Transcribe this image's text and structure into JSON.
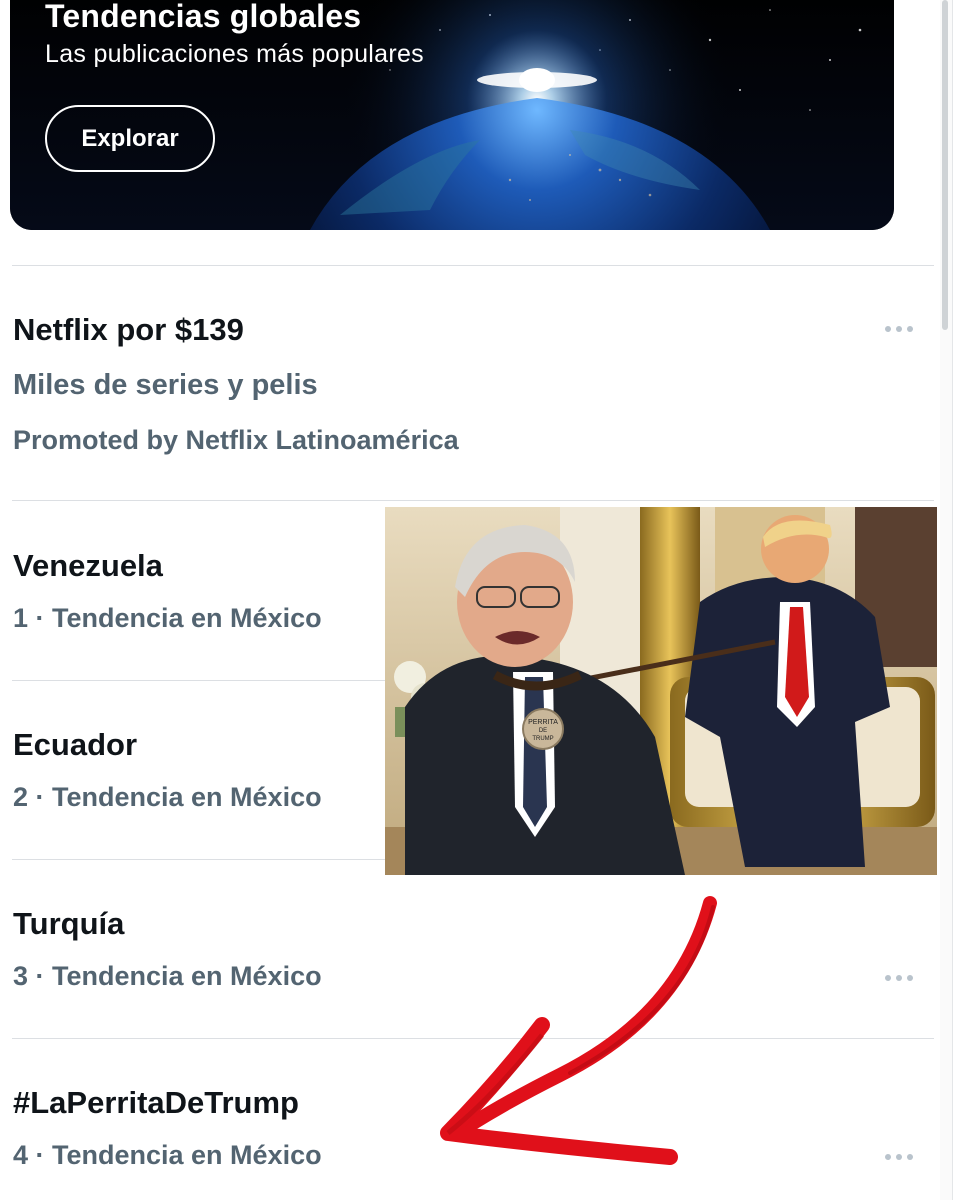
{
  "banner": {
    "title": "Tendencias globales",
    "subtitle": "Las publicaciones más populares",
    "button_label": "Explorar"
  },
  "promoted": {
    "title": "Netflix por $139",
    "subtitle": "Miles de series y pelis",
    "sponsor": "Promoted by Netflix Latinoamérica"
  },
  "trends": [
    {
      "title": "Venezuela",
      "meta": "1 · Tendencia en México"
    },
    {
      "title": "Ecuador",
      "meta": "2 · Tendencia en México"
    },
    {
      "title": "Turquía",
      "meta": "3 · Tendencia en México"
    },
    {
      "title": "#LaPerritaDeTrump",
      "meta": "4 · Tendencia en México"
    }
  ],
  "photo": {
    "tag_text_line1": "PERRITA",
    "tag_text_line2": "DE",
    "tag_text_line3": "TRUMP"
  },
  "colors": {
    "text_primary": "#0f1419",
    "text_secondary": "#536471",
    "divider": "#dcdfe3",
    "arrow_red": "#e0101a"
  },
  "icons": [
    "more-icon",
    "red-arrow-annotation"
  ]
}
